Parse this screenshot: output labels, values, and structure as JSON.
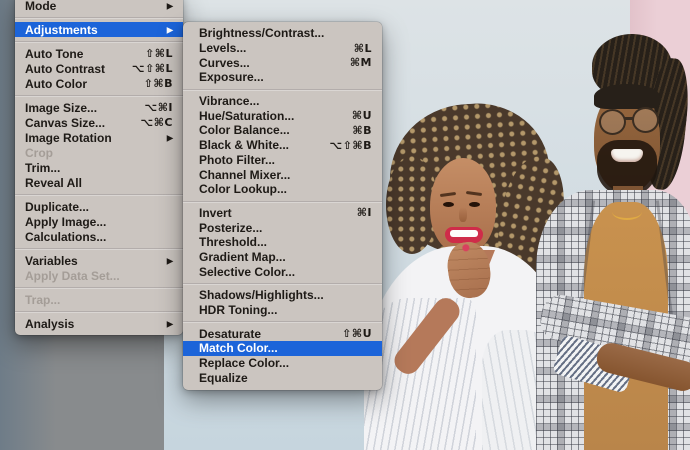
{
  "colors": {
    "menu_bg": "#cbc5c0",
    "menu_text": "#1e1a16",
    "menu_text_disabled": "#a49d97",
    "highlight": "#1c64d9",
    "highlight_text": "#ffffff",
    "separator": "#b3adab",
    "wall_blue_top": "#dde3e6",
    "wall_blue": "#c6d5de",
    "wall_gray": "#888b8d",
    "wall_gray_left": "#6e7c88",
    "wall_pink": "#ebcfd6",
    "blouse_white": "#f3f3f5",
    "woman_skin": "#b5795a",
    "woman_hair": "#4a392b",
    "lips_red": "#cf2c49",
    "man_hair": "#272019",
    "tshirt_mustard": "#b9854a",
    "blazer_light": "#e1e2e5",
    "cuff_stripe": "#667085",
    "necklace_gold": "#e0aa44"
  },
  "image_menu": {
    "items": [
      {
        "label": "Mode",
        "submenu": true
      },
      {
        "type": "separator"
      },
      {
        "label": "Adjustments",
        "submenu": true,
        "state": "highlighted"
      },
      {
        "type": "separator"
      },
      {
        "label": "Auto Tone",
        "shortcut": "⇧⌘L"
      },
      {
        "label": "Auto Contrast",
        "shortcut": "⌥⇧⌘L"
      },
      {
        "label": "Auto Color",
        "shortcut": "⇧⌘B"
      },
      {
        "type": "separator"
      },
      {
        "label": "Image Size...",
        "shortcut": "⌥⌘I"
      },
      {
        "label": "Canvas Size...",
        "shortcut": "⌥⌘C"
      },
      {
        "label": "Image Rotation",
        "submenu": true
      },
      {
        "label": "Crop",
        "disabled": true
      },
      {
        "label": "Trim..."
      },
      {
        "label": "Reveal All"
      },
      {
        "type": "separator"
      },
      {
        "label": "Duplicate..."
      },
      {
        "label": "Apply Image..."
      },
      {
        "label": "Calculations..."
      },
      {
        "type": "separator"
      },
      {
        "label": "Variables",
        "submenu": true
      },
      {
        "label": "Apply Data Set...",
        "disabled": true
      },
      {
        "type": "separator"
      },
      {
        "label": "Trap...",
        "disabled": true
      },
      {
        "type": "separator"
      },
      {
        "label": "Analysis",
        "submenu": true
      }
    ]
  },
  "adjustments_submenu": {
    "items": [
      {
        "label": "Brightness/Contrast..."
      },
      {
        "label": "Levels...",
        "shortcut": "⌘L"
      },
      {
        "label": "Curves...",
        "shortcut": "⌘M"
      },
      {
        "label": "Exposure..."
      },
      {
        "type": "separator"
      },
      {
        "label": "Vibrance..."
      },
      {
        "label": "Hue/Saturation...",
        "shortcut": "⌘U"
      },
      {
        "label": "Color Balance...",
        "shortcut": "⌘B"
      },
      {
        "label": "Black & White...",
        "shortcut": "⌥⇧⌘B"
      },
      {
        "label": "Photo Filter..."
      },
      {
        "label": "Channel Mixer..."
      },
      {
        "label": "Color Lookup..."
      },
      {
        "type": "separator"
      },
      {
        "label": "Invert",
        "shortcut": "⌘I"
      },
      {
        "label": "Posterize..."
      },
      {
        "label": "Threshold..."
      },
      {
        "label": "Gradient Map..."
      },
      {
        "label": "Selective Color..."
      },
      {
        "type": "separator"
      },
      {
        "label": "Shadows/Highlights..."
      },
      {
        "label": "HDR Toning..."
      },
      {
        "type": "separator"
      },
      {
        "label": "Desaturate",
        "shortcut": "⇧⌘U"
      },
      {
        "label": "Match Color...",
        "state": "highlighted"
      },
      {
        "label": "Replace Color..."
      },
      {
        "label": "Equalize"
      }
    ]
  }
}
